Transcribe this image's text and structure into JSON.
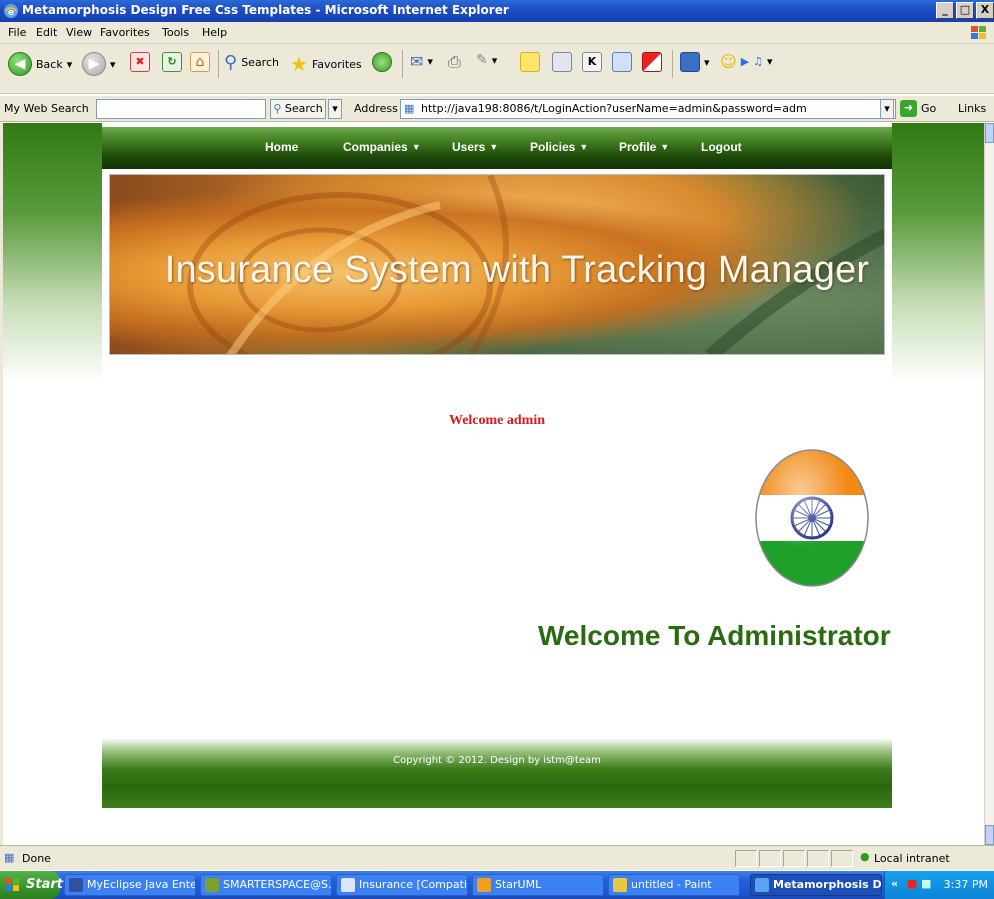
{
  "window": {
    "title": "Metamorphosis Design Free Css Templates - Microsoft Internet Explorer",
    "buttons": {
      "minimize": "_",
      "maximize": "□",
      "close": "X"
    }
  },
  "menubar": [
    "File",
    "Edit",
    "View",
    "Favorites",
    "Tools",
    "Help"
  ],
  "toolbar": {
    "back_label": "Back",
    "search_label": "Search",
    "favorites_label": "Favorites"
  },
  "addressbar": {
    "web_search_label": "My Web Search",
    "web_search_value": "",
    "search_button": "Search",
    "address_label": "Address",
    "url": "http://java198:8086/t/LoginAction?userName=admin&password=adm",
    "go_label": "Go",
    "links_label": "Links"
  },
  "site": {
    "nav": [
      {
        "label": "Home",
        "dropdown": false
      },
      {
        "label": "Companies",
        "dropdown": true
      },
      {
        "label": "Users",
        "dropdown": true
      },
      {
        "label": "Policies",
        "dropdown": true
      },
      {
        "label": "Profile",
        "dropdown": true
      },
      {
        "label": "Logout",
        "dropdown": false
      }
    ],
    "banner_title": "Insurance System with Tracking Manager",
    "welcome_user": "Welcome admin",
    "welcome_heading": "Welcome To Administrator",
    "copyright": "Copyright © 2012. Design by istm@team"
  },
  "statusbar": {
    "status": "Done",
    "zone": "Local intranet"
  },
  "taskbar": {
    "start_label": "Start",
    "tasks": [
      {
        "label": "MyEclipse Java Ente...",
        "active": false
      },
      {
        "label": "SMARTERSPACE@S...",
        "active": false
      },
      {
        "label": "Insurance [Compati...",
        "active": false
      },
      {
        "label": "StarUML",
        "active": false
      },
      {
        "label": "untitled - Paint",
        "active": false
      },
      {
        "label": "Metamorphosis D...",
        "active": true
      }
    ],
    "tray_chevron": "«",
    "clock": "3:37 PM"
  },
  "colors": {
    "nav_green": "#1f4a0a",
    "welcome_red": "#e01818",
    "heading_green": "#2a6a10",
    "xp_blue": "#245edc"
  }
}
